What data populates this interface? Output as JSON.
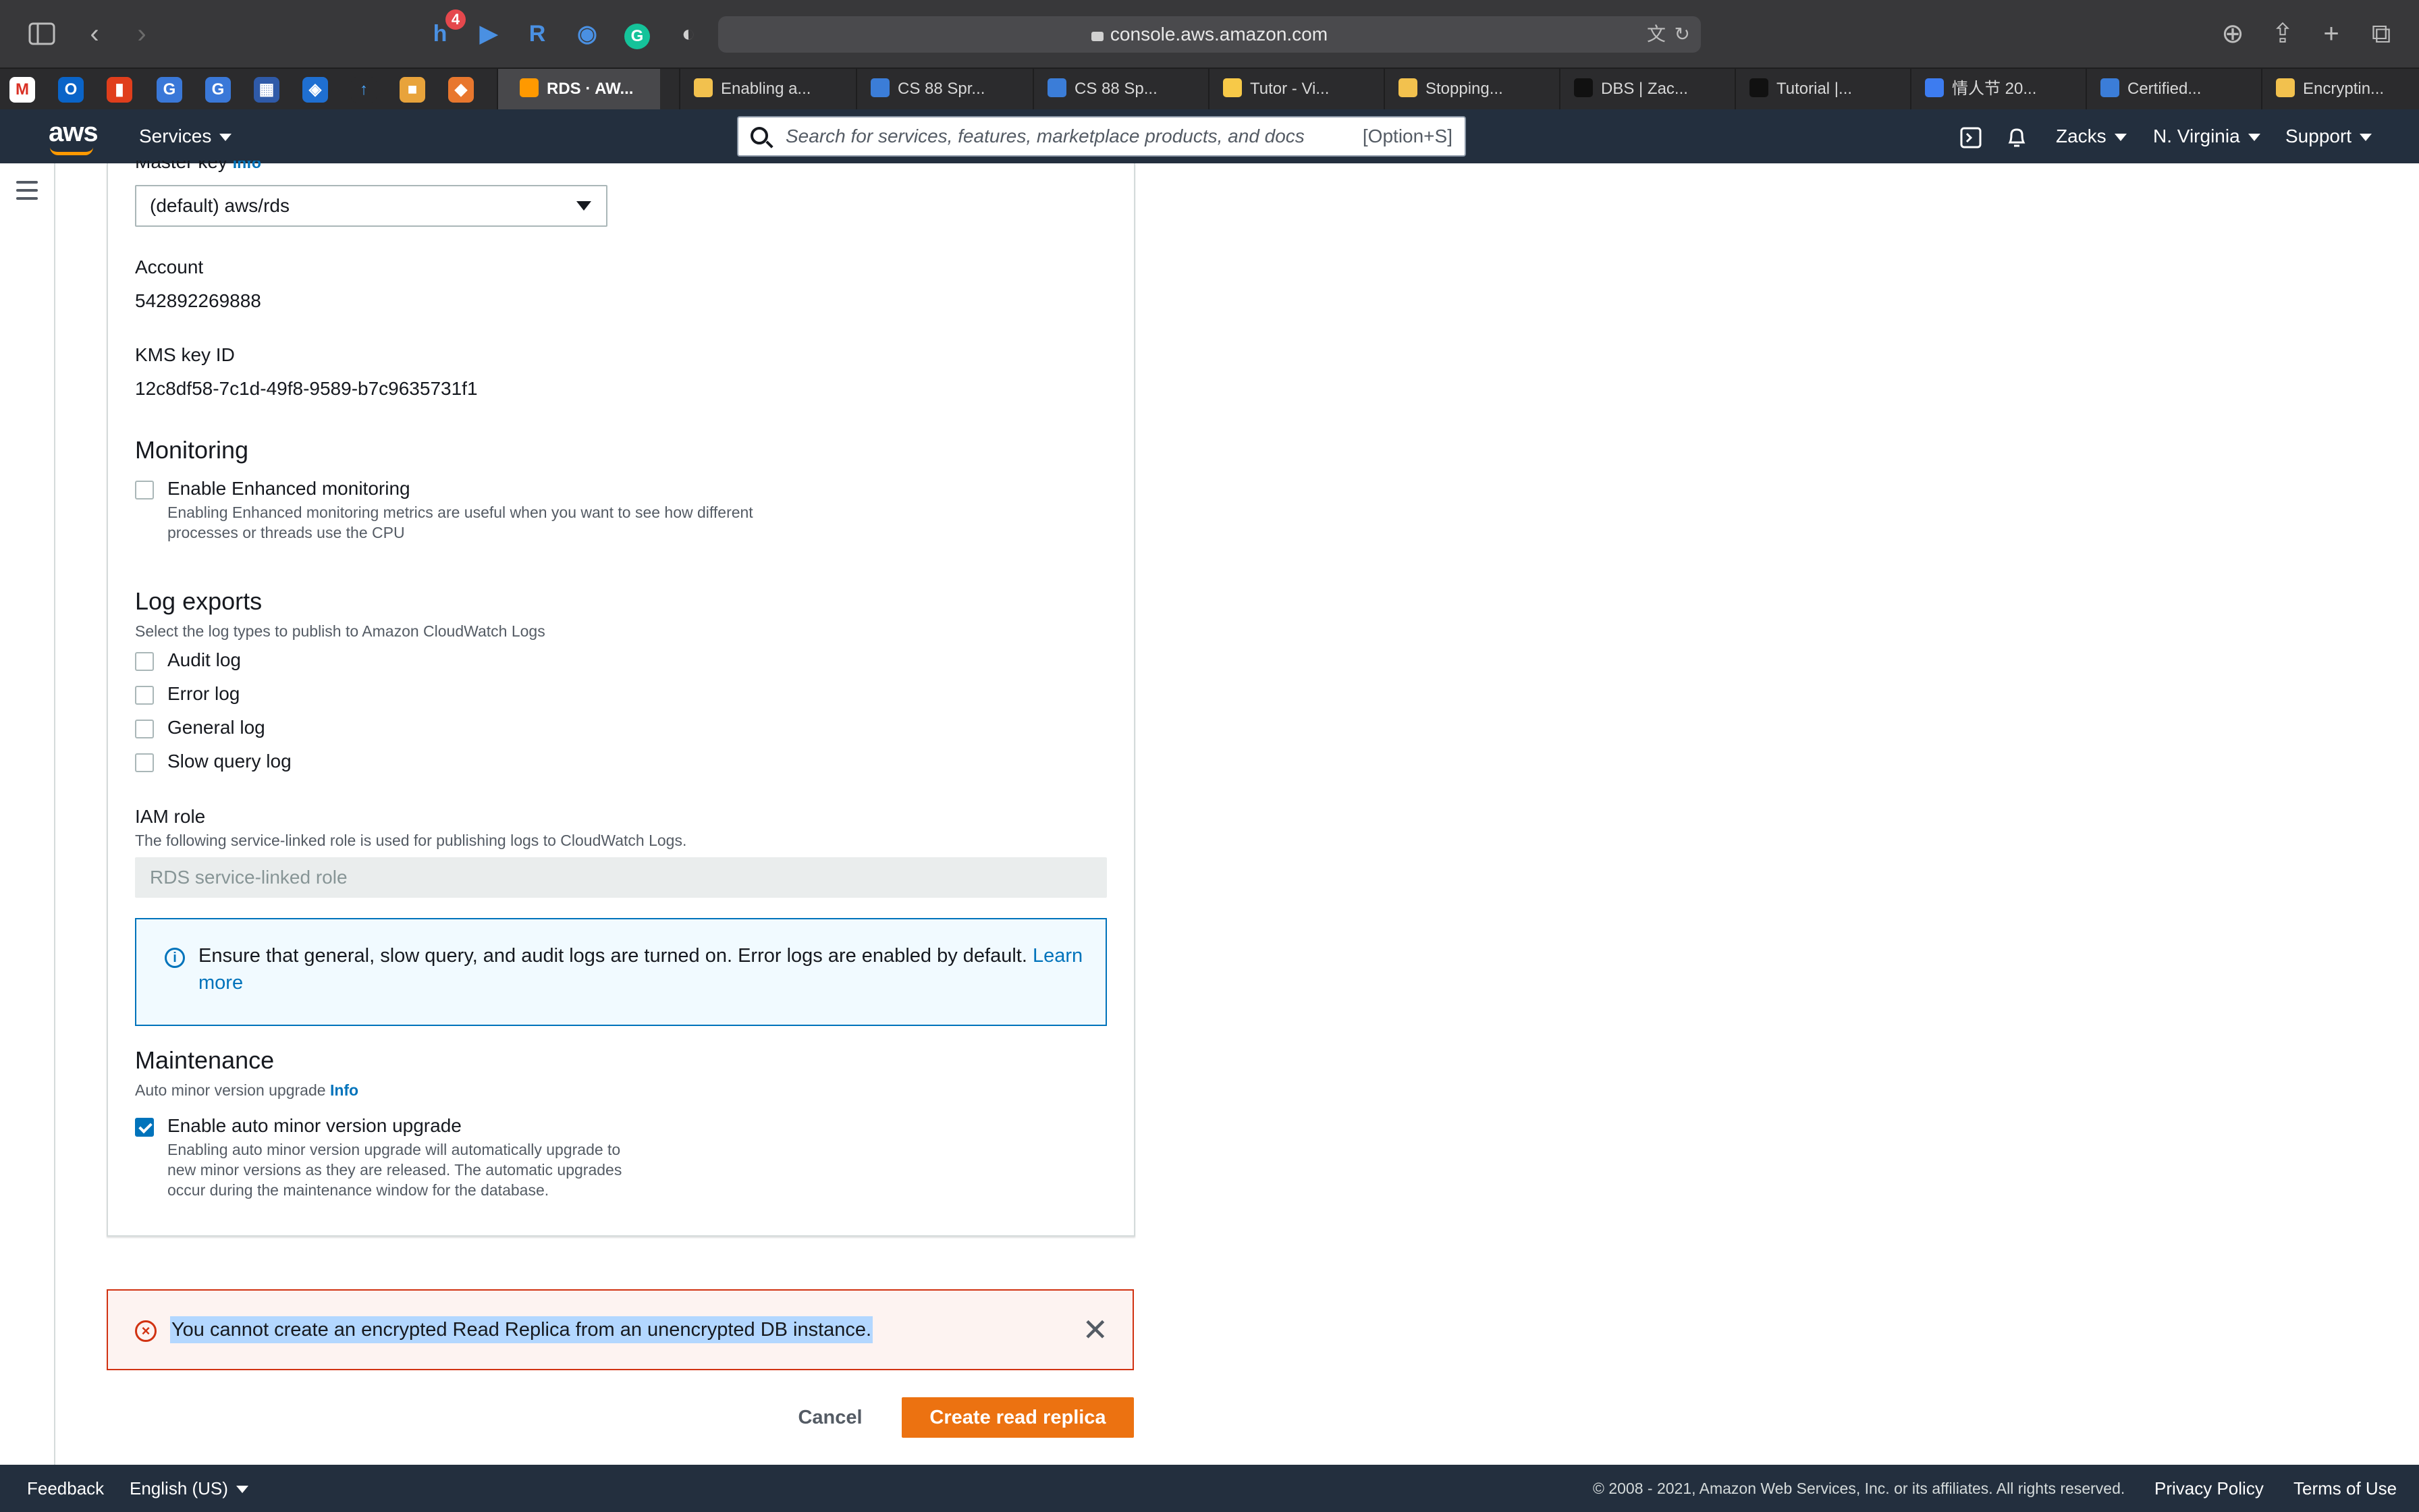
{
  "browser": {
    "url": "console.aws.amazon.com",
    "extension_badge": "4",
    "tabs": [
      {
        "label": "RDS · AW...",
        "active": true,
        "color": "#ff9900"
      },
      {
        "label": "Enabling a...",
        "active": false,
        "color": "#f2c14e"
      },
      {
        "label": "CS 88 Spr...",
        "active": false,
        "color": "#3b7dd8"
      },
      {
        "label": "CS 88 Sp...",
        "active": false,
        "color": "#3b7dd8"
      },
      {
        "label": "Tutor - Vi...",
        "active": false,
        "color": "#f7c948"
      },
      {
        "label": "Stopping...",
        "active": false,
        "color": "#f2c14e"
      },
      {
        "label": "DBS | Zac...",
        "active": false,
        "color": "#1b1b1b"
      },
      {
        "label": "Tutorial |...",
        "active": false,
        "color": "#1b1b1b"
      },
      {
        "label": "情人节 20...",
        "active": false,
        "color": "#3d7cf0"
      },
      {
        "label": "Certified...",
        "active": false,
        "color": "#3b7dd8"
      },
      {
        "label": "Encryptin...",
        "active": false,
        "color": "#f2c14e"
      }
    ]
  },
  "awsnav": {
    "logo": "aws",
    "services": "Services",
    "search_placeholder": "Search for services, features, marketplace products, and docs",
    "search_shortcut": "[Option+S]",
    "user": "Zacks",
    "region": "N. Virginia",
    "support": "Support"
  },
  "form": {
    "master_key_label": "Master key",
    "master_key_info": "Info",
    "master_key_value": "(default) aws/rds",
    "account_label": "Account",
    "account_value": "542892269888",
    "kms_label": "KMS key ID",
    "kms_value": "12c8df58-7c1d-49f8-9589-b7c9635731f1",
    "monitoring_title": "Monitoring",
    "enhanced_label": "Enable Enhanced monitoring",
    "enhanced_desc_1": "Enabling Enhanced monitoring metrics are useful when you want to see how different",
    "enhanced_desc_2": "processes or threads use the CPU",
    "log_title": "Log exports",
    "log_desc": "Select the log types to publish to Amazon CloudWatch Logs",
    "logs": [
      "Audit log",
      "Error log",
      "General log",
      "Slow query log"
    ],
    "iam_label": "IAM role",
    "iam_desc": "The following service-linked role is used for publishing logs to CloudWatch Logs.",
    "iam_value": "RDS service-linked role",
    "alert_text": "Ensure that general, slow query, and audit logs are turned on. Error logs are enabled by default. ",
    "alert_link_1": "Learn",
    "alert_link_2": "more",
    "maintenance_title": "Maintenance",
    "amvu_label": "Auto minor version upgrade",
    "amvu_info": "Info",
    "amvu_checkbox_label": "Enable auto minor version upgrade",
    "amvu_desc_1": "Enabling auto minor version upgrade will automatically upgrade to",
    "amvu_desc_2": "new minor versions as they are released. The automatic upgrades",
    "amvu_desc_3": "occur during the maintenance window for the database."
  },
  "error": {
    "message": "You cannot create an encrypted Read Replica from an unencrypted DB instance."
  },
  "actions": {
    "cancel": "Cancel",
    "create": "Create read replica"
  },
  "footer": {
    "feedback": "Feedback",
    "language": "English (US)",
    "copyright": "© 2008 - 2021, Amazon Web Services, Inc. or its affiliates. All rights reserved.",
    "privacy": "Privacy Policy",
    "terms": "Terms of Use"
  }
}
